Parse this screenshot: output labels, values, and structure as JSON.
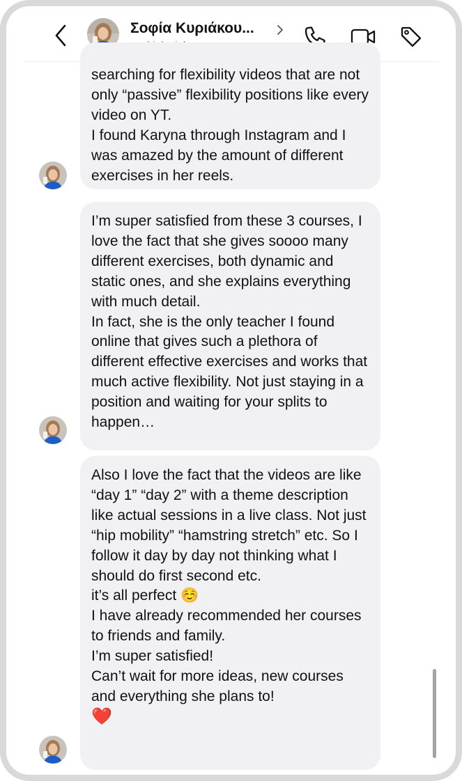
{
  "header": {
    "contact_name": "Σοφία Κυριάκου...",
    "handle": "sophiekyriakou",
    "icons": [
      "back-chevron-icon",
      "chevron-right-icon",
      "phone-icon",
      "video-camera-icon",
      "tag-icon"
    ]
  },
  "messages": [
    {
      "paragraphs": [
        "searching for flexibility videos that are not only “passive” flexibility positions like every video on YT.",
        "I found Karyna through Instagram and I was amazed by the amount of different exercises in her reels."
      ]
    },
    {
      "paragraphs": [
        "I’m super satisfied from these 3 courses, I love the fact that she gives soooo many different exercises, both dynamic and static ones, and she explains everything with much detail.",
        "In fact, she is the only teacher I found online that gives such a plethora of different effective  exercises and works that much active flexibility. Not just staying in a position and waiting for your splits to happen…"
      ]
    },
    {
      "paragraphs": [
        "Also I love the fact that the videos are like “day  1” “day 2” with a theme description like actual sessions in a live class. Not just “hip mobility” “hamstring stretch” etc. So I follow it day by day not thinking what I should do first second etc.",
        "it’s all perfect ☺️",
        "I have already recommended her courses to friends and family.",
        "I’m super satisfied!",
        "Can’t wait for more ideas, new courses and everything she plans to!",
        "❤️"
      ]
    }
  ],
  "colors": {
    "bubble_bg": "#f1f1f3",
    "frame_border": "#d9d9d9",
    "handle_text": "#8e8e8e"
  }
}
